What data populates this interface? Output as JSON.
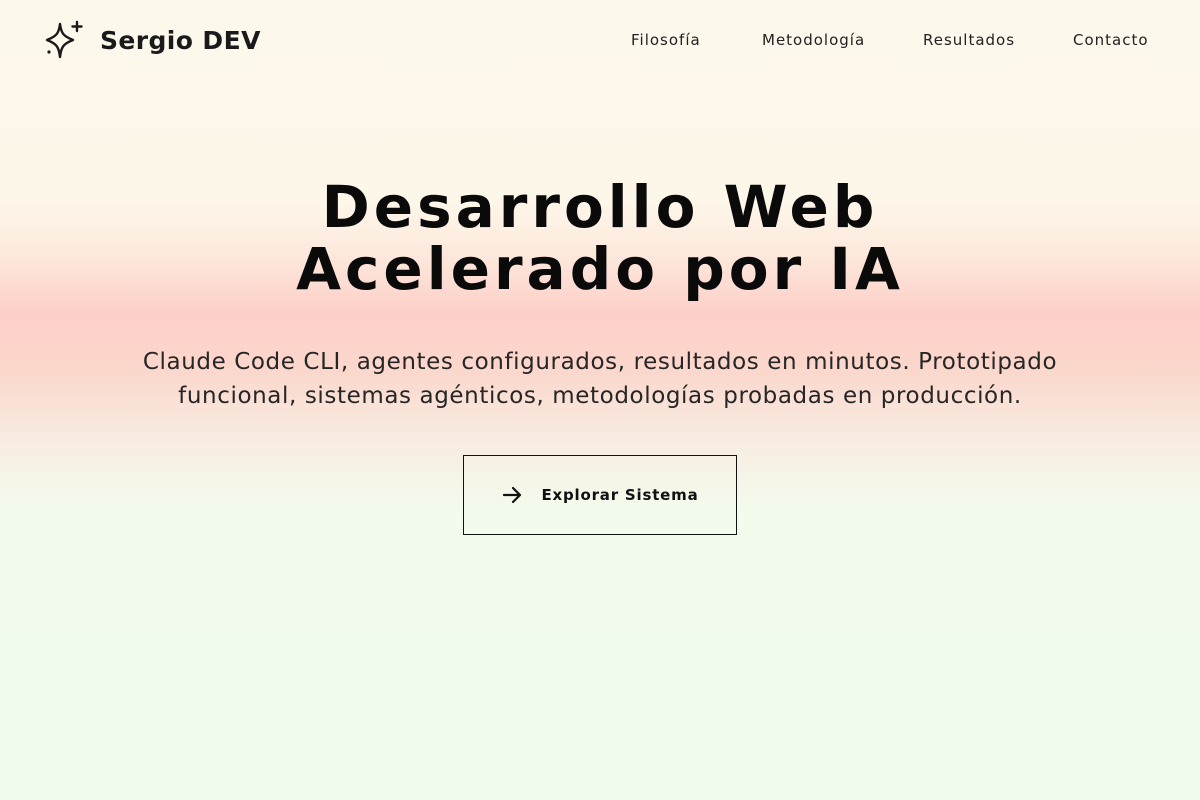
{
  "brand": {
    "name": "Sergio DEV",
    "icon": "sparkle-icon"
  },
  "nav": {
    "items": [
      {
        "label": "Filosofía"
      },
      {
        "label": "Metodología"
      },
      {
        "label": "Resultados"
      },
      {
        "label": "Contacto"
      }
    ]
  },
  "hero": {
    "title_line1": "Desarrollo Web",
    "title_line2": "Acelerado por IA",
    "subtitle_line1": "Claude Code CLI, agentes configurados, resultados en minutos. Prototipado",
    "subtitle_line2": "funcional, sistemas agénticos, metodologías probadas en producción.",
    "cta_label": "Explorar Sistema",
    "cta_icon": "arrow-right-icon"
  },
  "colors": {
    "text": "#111111",
    "background_top": "#fdf8ec",
    "background_band": "#fdcfc8",
    "background_bottom": "#f2fcec"
  }
}
